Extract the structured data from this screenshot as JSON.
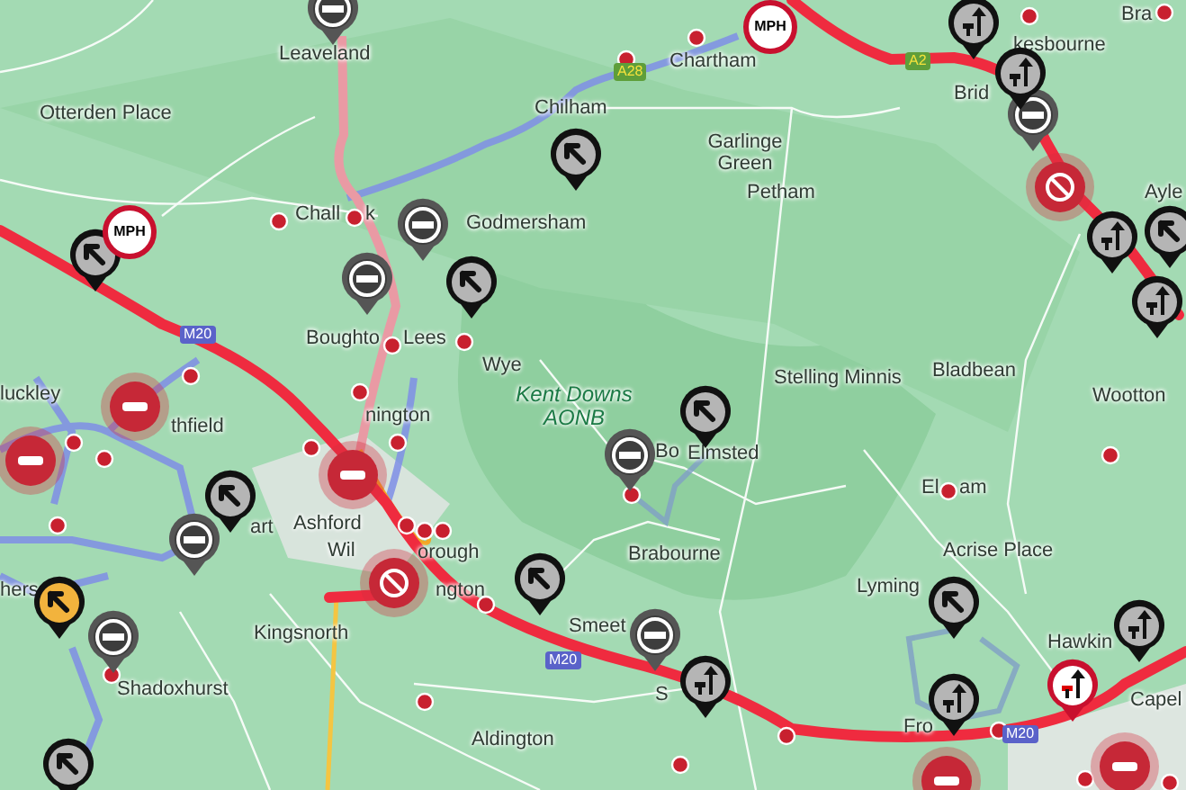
{
  "map": {
    "places": [
      {
        "name": "Otterden Place"
      },
      {
        "name": "Leaveland"
      },
      {
        "name": "Chartham"
      },
      {
        "name": "Chilham"
      },
      {
        "name": "Garlinge Green"
      },
      {
        "name": "Petham"
      },
      {
        "name": "Godmersham"
      },
      {
        "name": "Chall"
      },
      {
        "name": "k"
      },
      {
        "name": "Boughto"
      },
      {
        "name": "Lees"
      },
      {
        "name": "Wye"
      },
      {
        "name": "Kent Downs AONB",
        "kind": "area"
      },
      {
        "name": "Bo"
      },
      {
        "name": "Elmsted"
      },
      {
        "name": "Stelling Minnis"
      },
      {
        "name": "Bladbean"
      },
      {
        "name": "Wootton"
      },
      {
        "name": "Ayle"
      },
      {
        "name": "kesbourne"
      },
      {
        "name": "Brid"
      },
      {
        "name": "Bra"
      },
      {
        "name": "El"
      },
      {
        "name": "am"
      },
      {
        "name": "Acrise Place"
      },
      {
        "name": "Lyming"
      },
      {
        "name": "Hawkin"
      },
      {
        "name": "Capel"
      },
      {
        "name": "Brabourne"
      },
      {
        "name": "Smeet"
      },
      {
        "name": "S"
      },
      {
        "name": "Fro"
      },
      {
        "name": "Aldington"
      },
      {
        "name": "Kingsnorth"
      },
      {
        "name": "Shadoxhurst"
      },
      {
        "name": "Ashford"
      },
      {
        "name": "Wil"
      },
      {
        "name": "orough"
      },
      {
        "name": "ngton"
      },
      {
        "name": "nington"
      },
      {
        "name": "thfield"
      },
      {
        "name": "luckley"
      },
      {
        "name": "art"
      },
      {
        "name": "hers"
      }
    ],
    "shields": [
      {
        "label": "M20",
        "kind": "motorway"
      },
      {
        "label": "A28",
        "kind": "a-road"
      },
      {
        "label": "A2",
        "kind": "a-road"
      },
      {
        "label": "M20",
        "kind": "motorway"
      },
      {
        "label": "M20",
        "kind": "motorway"
      }
    ],
    "markers": [
      {
        "kind": "closure"
      },
      {
        "kind": "closure"
      },
      {
        "kind": "closure"
      },
      {
        "kind": "closure"
      },
      {
        "kind": "closure"
      },
      {
        "kind": "closure"
      },
      {
        "kind": "closure"
      },
      {
        "kind": "closure"
      },
      {
        "kind": "roadworks"
      },
      {
        "kind": "roadworks"
      },
      {
        "kind": "roadworks"
      },
      {
        "kind": "roadworks"
      },
      {
        "kind": "roadworks"
      },
      {
        "kind": "roadworks"
      },
      {
        "kind": "roadworks"
      },
      {
        "kind": "roadworks"
      },
      {
        "kind": "roadworks"
      },
      {
        "kind": "roadworks-warning"
      },
      {
        "kind": "lanes"
      },
      {
        "kind": "lanes"
      },
      {
        "kind": "lanes"
      },
      {
        "kind": "lanes"
      },
      {
        "kind": "lanes"
      },
      {
        "kind": "lanes"
      },
      {
        "kind": "lanes"
      },
      {
        "kind": "incident"
      },
      {
        "kind": "incident"
      },
      {
        "kind": "incident"
      },
      {
        "kind": "incident"
      },
      {
        "kind": "incident"
      },
      {
        "kind": "no-entry"
      },
      {
        "kind": "no-entry"
      },
      {
        "kind": "speed",
        "text": "MPH"
      },
      {
        "kind": "speed",
        "text": "MPH"
      },
      {
        "kind": "lane-warning"
      }
    ]
  }
}
